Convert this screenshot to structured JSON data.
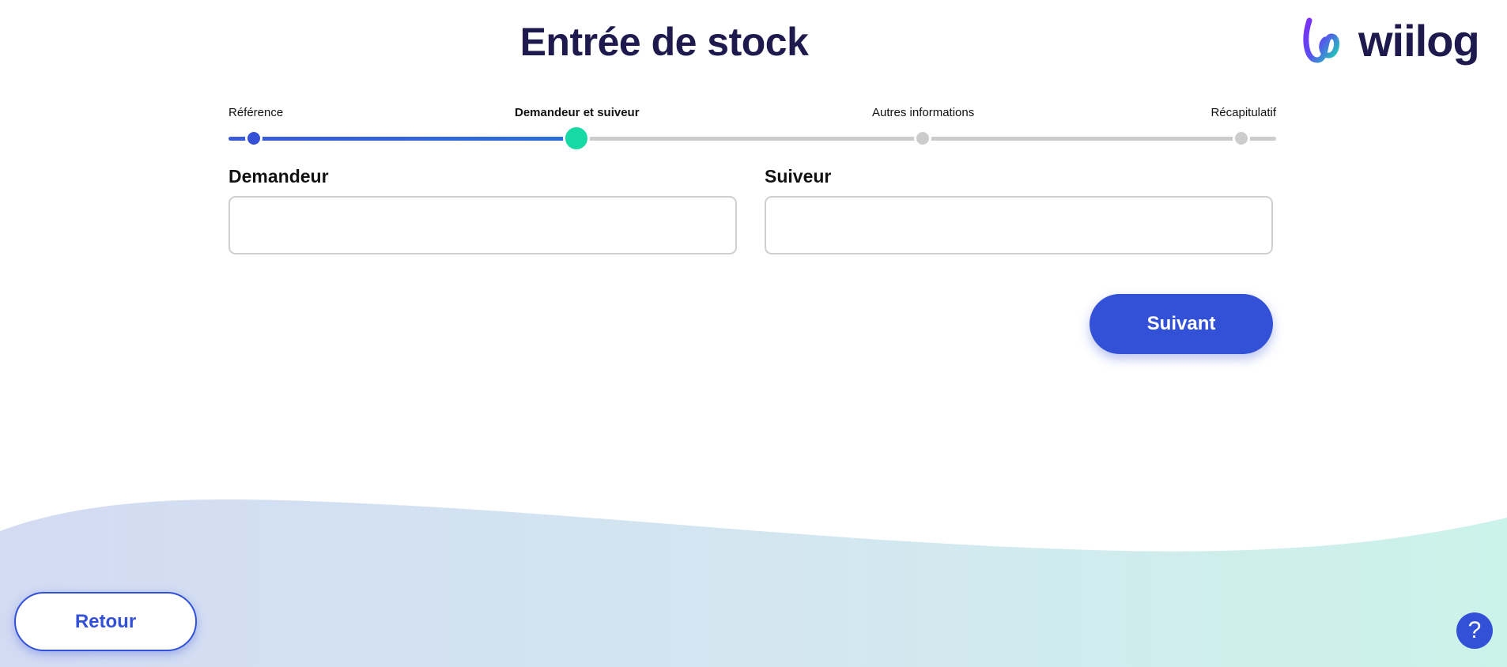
{
  "header": {
    "title": "Entrée de stock",
    "logo_text": "wiilog"
  },
  "stepper": {
    "steps": [
      {
        "label": "Référence",
        "state": "done"
      },
      {
        "label": "Demandeur et suiveur",
        "state": "active"
      },
      {
        "label": "Autres informations",
        "state": "todo"
      },
      {
        "label": "Récapitulatif",
        "state": "todo"
      }
    ],
    "current_step": 2
  },
  "form": {
    "requester": {
      "label": "Demandeur",
      "value": "",
      "placeholder": ""
    },
    "follower": {
      "label": "Suiveur",
      "value": "",
      "placeholder": ""
    }
  },
  "actions": {
    "next_label": "Suivant",
    "back_label": "Retour",
    "help_label": "?"
  },
  "colors": {
    "primary": "#3351d6",
    "active_step": "#17d9a6",
    "title": "#1f1a4d",
    "inactive": "#cccccc"
  },
  "icons": {
    "logo": "wiilog-logo-icon",
    "help": "question-mark-icon"
  }
}
